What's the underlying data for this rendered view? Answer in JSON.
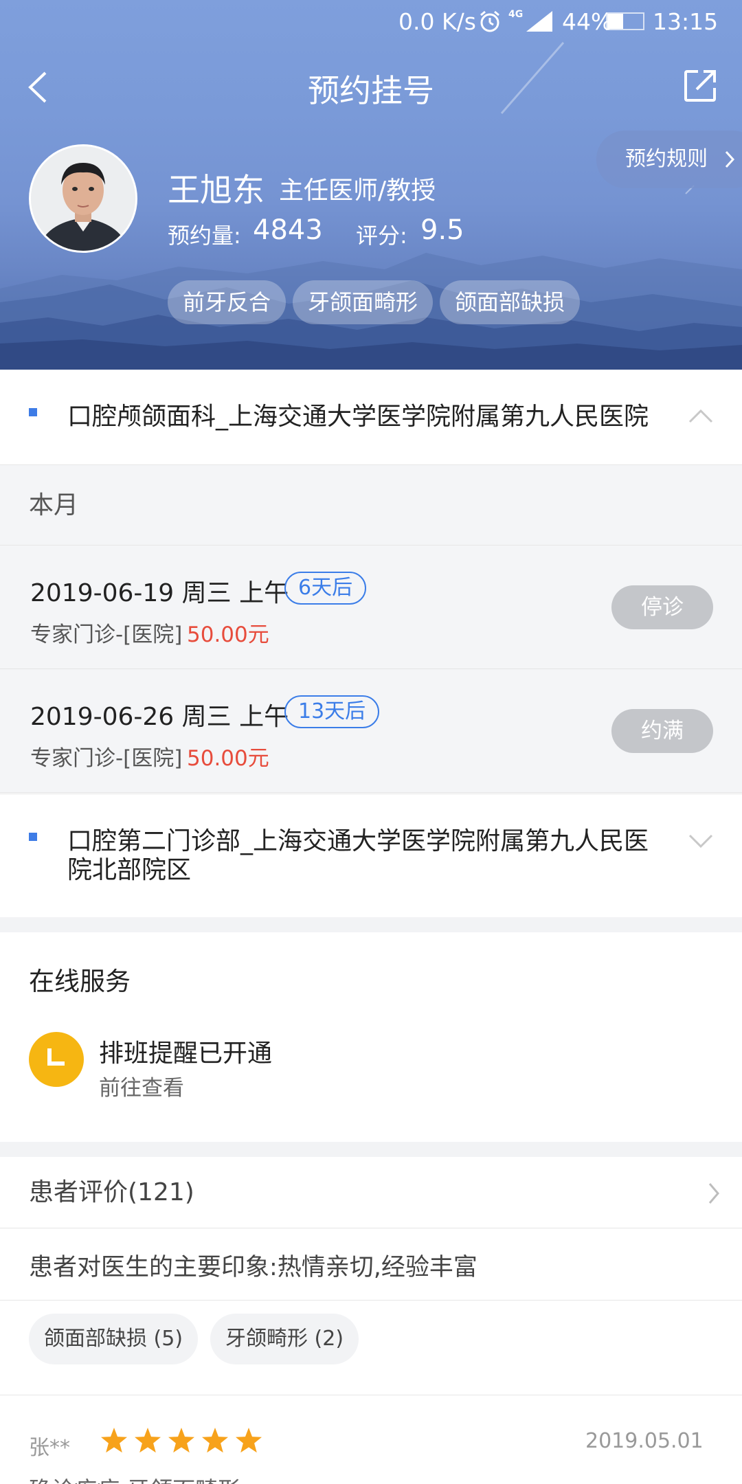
{
  "status_bar": {
    "speed": "0.0 K/s",
    "network": "4G",
    "battery": "44%",
    "battery_level": 0.44,
    "time": "13:15"
  },
  "nav": {
    "title": "预约挂号",
    "back_icon": "back-arrow-icon",
    "share_icon": "share-icon"
  },
  "rules_button": "预约规则",
  "doctor": {
    "name": "王旭东",
    "title": "主任医师/教授",
    "appointments_label": "预约量:",
    "appointments": "4843",
    "rating_label": "评分:",
    "rating": "9.5",
    "specialties": [
      "前牙反合",
      "牙颌面畸形",
      "颌面部缺损"
    ]
  },
  "hospitals": [
    {
      "name": "口腔颅颌面科_上海交通大学医学院附属第九人民医院",
      "expanded": true
    },
    {
      "name": "口腔第二门诊部_上海交通大学医学院附属第九人民医院北部院区",
      "expanded": false
    }
  ],
  "month_label": "本月",
  "slots": [
    {
      "date": "2019-06-19 周三 上午",
      "days": "6天后",
      "type": "专家门诊-[医院]",
      "price": "50.00元",
      "status": "停诊"
    },
    {
      "date": "2019-06-26 周三 上午",
      "days": "13天后",
      "type": "专家门诊-[医院]",
      "price": "50.00元",
      "status": "约满"
    }
  ],
  "online_service": {
    "title": "在线服务",
    "item_title": "排班提醒已开通",
    "item_sub": "前往查看",
    "icon": "clock-icon"
  },
  "reviews": {
    "header": "患者评价(121)",
    "impression": "患者对医生的主要印象:热情亲切,经验丰富",
    "tags": [
      "颌面部缺损 (5)",
      "牙颌畸形 (2)"
    ],
    "first": {
      "user": "张**",
      "stars": 5,
      "date": "2019.05.01",
      "text": "确诊疾病:牙颌面畸形"
    }
  },
  "colors": {
    "accent": "#3b7de8",
    "price": "#e74c3c",
    "star": "#f7a21b",
    "header": "#7a9ad8"
  }
}
